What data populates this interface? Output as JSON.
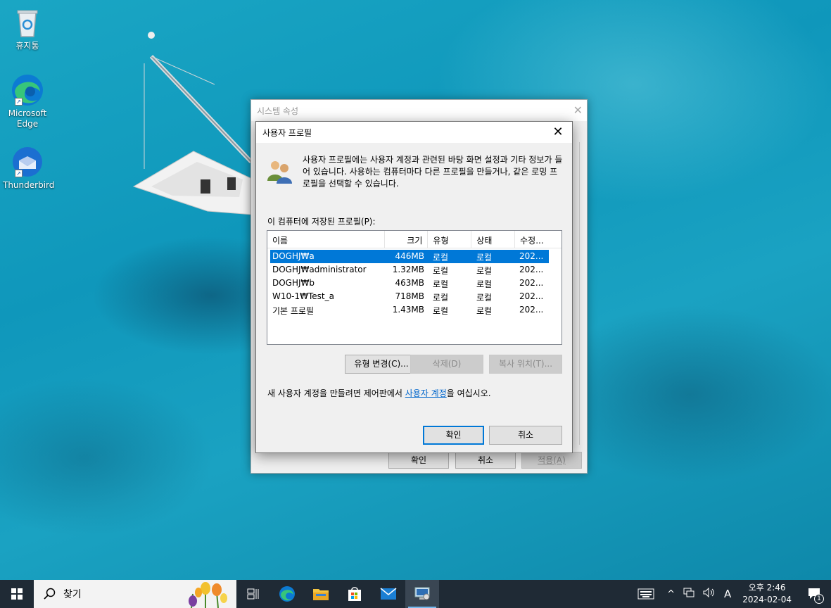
{
  "desktop": {
    "icons": [
      {
        "label": "휴지통"
      },
      {
        "label": "Microsoft Edge"
      },
      {
        "label": "Thunderbird"
      }
    ]
  },
  "sysprops": {
    "title": "시스템 속성",
    "ok": "확인",
    "cancel": "취소",
    "apply": "적용(A)"
  },
  "dialog": {
    "title": "사용자 프로필",
    "intro": "사용자 프로필에는 사용자 계정과 관련된 바탕 화면 설정과 기타 정보가 들어 있습니다. 사용하는 컴퓨터마다 다른 프로필을 만들거나, 같은 로밍 프로필을 선택할 수 있습니다.",
    "list_label": "이 컴퓨터에 저장된 프로필(P):",
    "columns": [
      "이름",
      "크기",
      "유형",
      "상태",
      "수정..."
    ],
    "rows": [
      {
        "name": "DOGHJ₩a",
        "size": "446MB",
        "type": "로컬",
        "status": "로컬",
        "modified": "202..."
      },
      {
        "name": "DOGHJ₩administrator",
        "size": "1.32MB",
        "type": "로컬",
        "status": "로컬",
        "modified": "202..."
      },
      {
        "name": "DOGHJ₩b",
        "size": "463MB",
        "type": "로컬",
        "status": "로컬",
        "modified": "202..."
      },
      {
        "name": "W10-1₩Test_a",
        "size": "718MB",
        "type": "로컬",
        "status": "로컬",
        "modified": "202..."
      },
      {
        "name": "기본 프로필",
        "size": "1.43MB",
        "type": "로컬",
        "status": "로컬",
        "modified": "202..."
      }
    ],
    "change_type": "유형 변경(C)...",
    "delete": "삭제(D)",
    "copy_to": "복사 위치(T)...",
    "note_prefix": "새 사용자 계정을 만들려면 제어판에서 ",
    "note_link": "사용자 계정",
    "note_suffix": "을 여십시오.",
    "ok": "확인",
    "cancel": "취소"
  },
  "taskbar": {
    "search_placeholder": "찾기",
    "ime": "A",
    "time": "오후 2:46",
    "date": "2024-02-04",
    "notification_count": "1"
  },
  "colors": {
    "accent": "#0078d7",
    "taskbar": "#1f2a35"
  }
}
